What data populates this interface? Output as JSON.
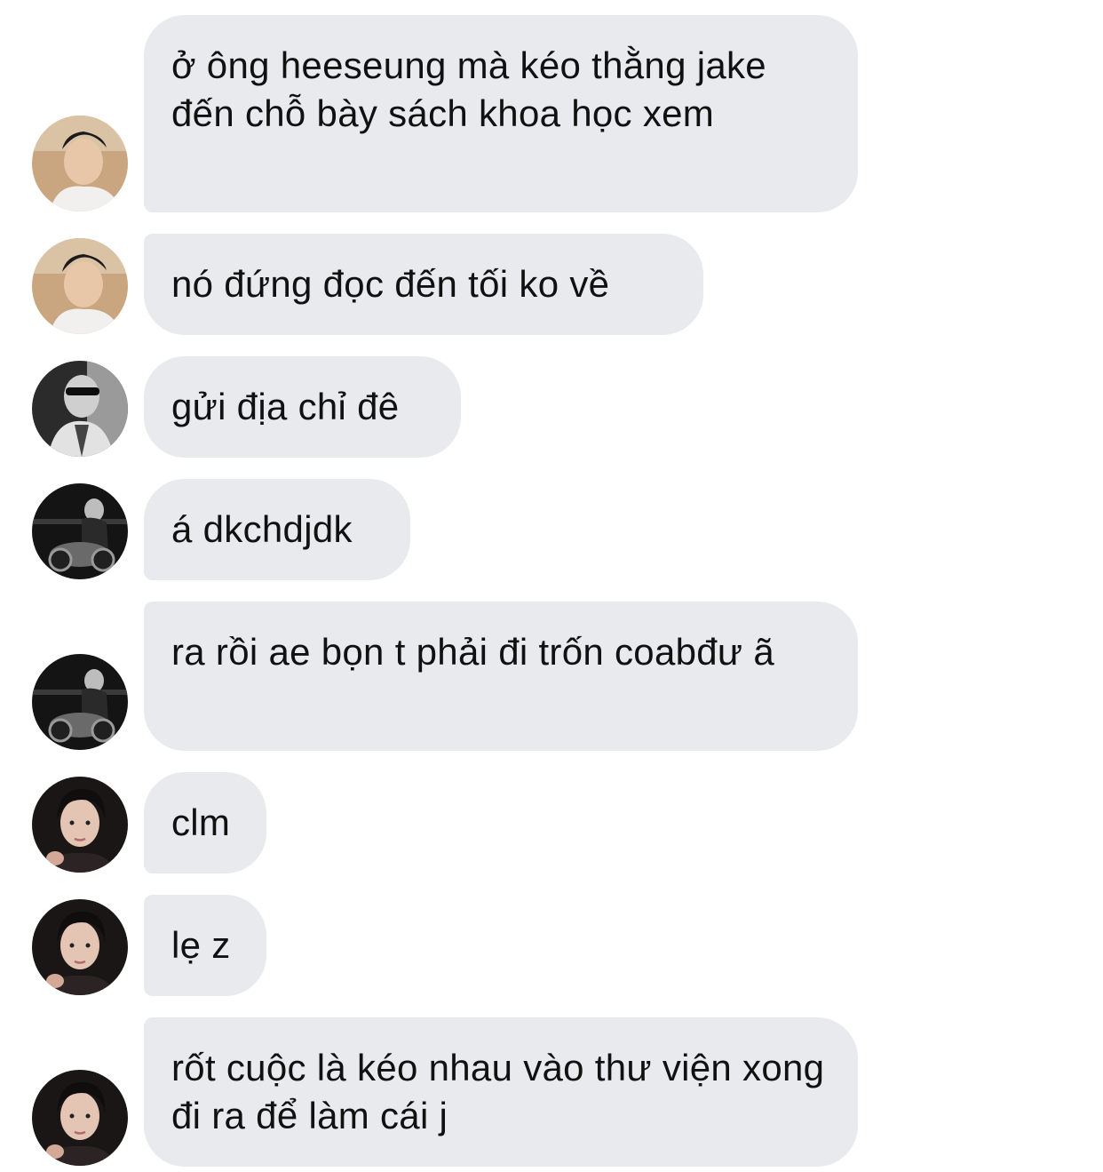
{
  "colors": {
    "bubble_bg": "#e8eaee",
    "text": "#111111",
    "background": "#ffffff"
  },
  "messages": [
    {
      "avatar": "avatar-beach-user-icon",
      "text": "ở ông heeseung mà kéo thằng jake đến chỗ bày sách khoa học xem"
    },
    {
      "avatar": "avatar-beach-user-icon",
      "text": "nó đứng đọc đến tối ko về"
    },
    {
      "avatar": "avatar-sunglasses-user-icon",
      "text": "gửi địa chỉ đê"
    },
    {
      "avatar": "avatar-motorbike-user-icon",
      "text": "á dkchdjdk"
    },
    {
      "avatar": "avatar-motorbike-user-icon",
      "text": "ra rồi ae bọn t phải đi trốn coabđư ã"
    },
    {
      "avatar": "avatar-portrait-user-icon",
      "text": "clm"
    },
    {
      "avatar": "avatar-portrait-user-icon",
      "text": "lẹ z"
    },
    {
      "avatar": "avatar-portrait-user-icon",
      "text": "rốt cuộc là kéo nhau vào thư viện xong đi ra để làm cái j"
    }
  ]
}
